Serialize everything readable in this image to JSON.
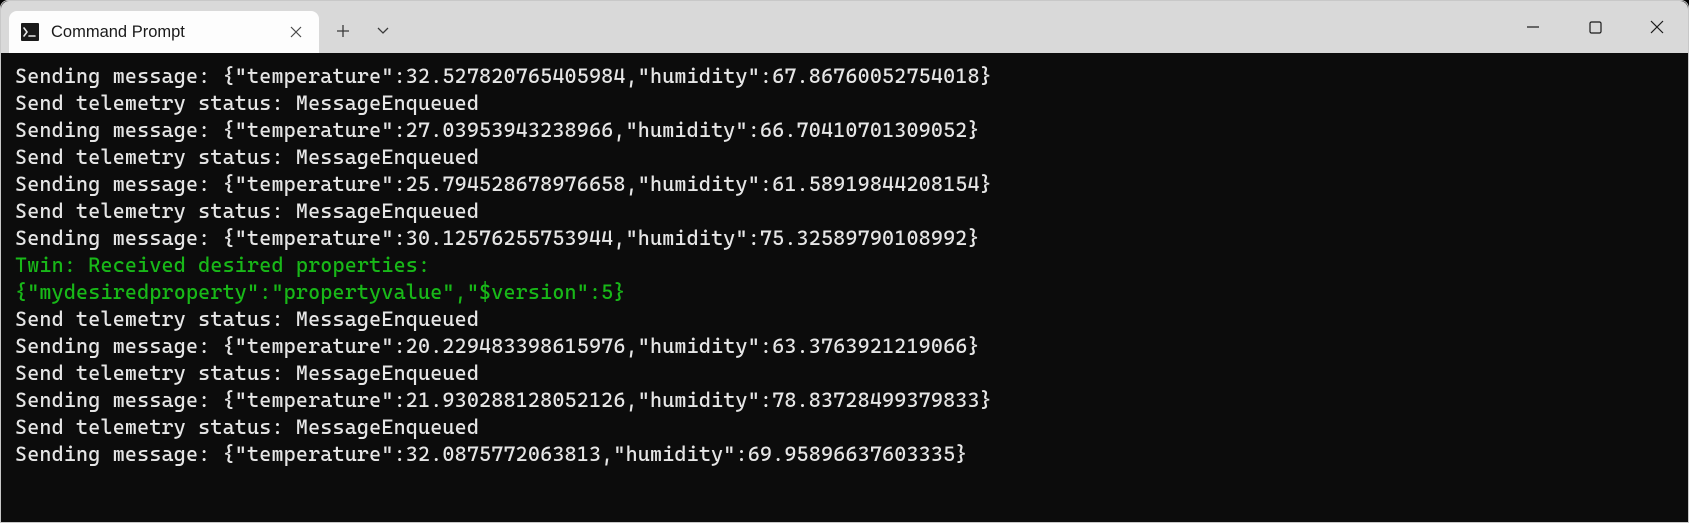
{
  "window": {
    "tab_title": "Command Prompt"
  },
  "terminal": {
    "lines": [
      {
        "text": "Sending message: {\"temperature\":32.527820765405984,\"humidity\":67.86760052754018}",
        "color": "default"
      },
      {
        "text": "Send telemetry status: MessageEnqueued",
        "color": "default"
      },
      {
        "text": "Sending message: {\"temperature\":27.03953943238966,\"humidity\":66.70410701309052}",
        "color": "default"
      },
      {
        "text": "Send telemetry status: MessageEnqueued",
        "color": "default"
      },
      {
        "text": "Sending message: {\"temperature\":25.794528678976658,\"humidity\":61.58919844208154}",
        "color": "default"
      },
      {
        "text": "Send telemetry status: MessageEnqueued",
        "color": "default"
      },
      {
        "text": "Sending message: {\"temperature\":30.12576255753944,\"humidity\":75.32589790108992}",
        "color": "default"
      },
      {
        "text": "Twin: Received desired properties:",
        "color": "green"
      },
      {
        "text": "{\"mydesiredproperty\":\"propertyvalue\",\"$version\":5}",
        "color": "green"
      },
      {
        "text": "Send telemetry status: MessageEnqueued",
        "color": "default"
      },
      {
        "text": "Sending message: {\"temperature\":20.229483398615976,\"humidity\":63.3763921219066}",
        "color": "default"
      },
      {
        "text": "Send telemetry status: MessageEnqueued",
        "color": "default"
      },
      {
        "text": "Sending message: {\"temperature\":21.930288128052126,\"humidity\":78.83728499379833}",
        "color": "default"
      },
      {
        "text": "Send telemetry status: MessageEnqueued",
        "color": "default"
      },
      {
        "text": "Sending message: {\"temperature\":32.0875772063813,\"humidity\":69.95896637603335}",
        "color": "default"
      }
    ]
  }
}
